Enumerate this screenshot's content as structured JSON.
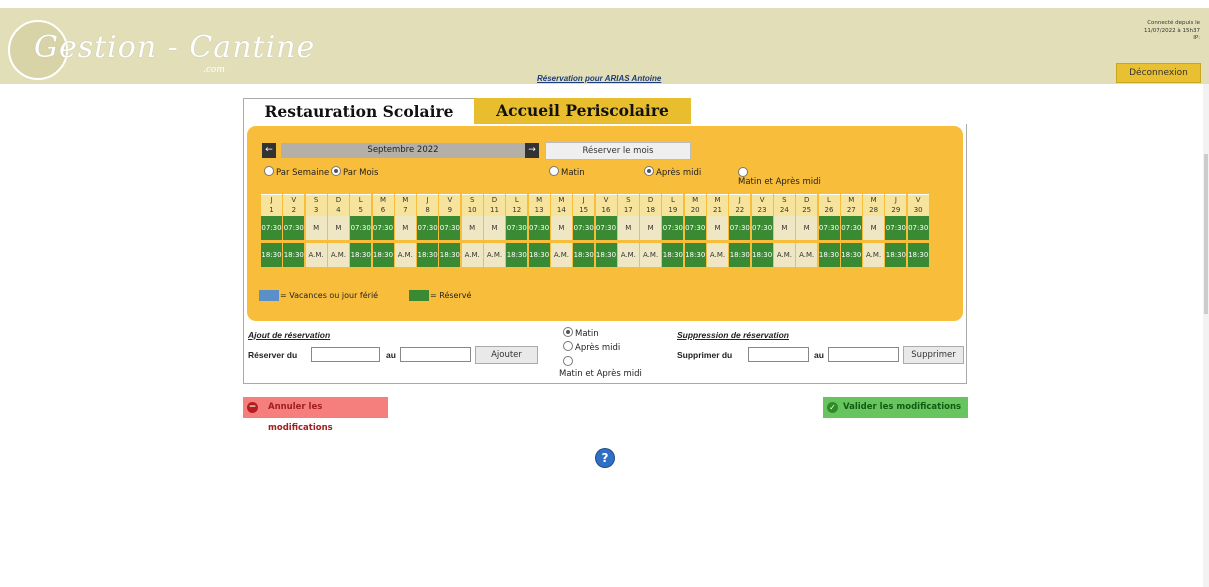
{
  "header": {
    "logo_text": "Gestion - Cantine",
    "logo_sub": ".com",
    "reservation_for": "Réservation pour ARIAS Antoine",
    "connection": [
      "Connecté depuis le",
      "11/07/2022 à 15h37",
      "IP:"
    ],
    "logout_label": "Déconnexion"
  },
  "tabs": [
    "Restauration Scolaire",
    "Accueil Periscolaire"
  ],
  "calendar": {
    "month_label": "Septembre 2022",
    "prev_icon": "←",
    "next_icon": "→",
    "reserve_month_label": "Réserver le mois",
    "view_options": [
      "Par Semaine",
      "Par Mois"
    ],
    "view_selected": "Par Mois",
    "period_options": [
      "Matin",
      "Après midi",
      "Matin et Après midi"
    ],
    "period_selected": "Après midi",
    "days": [
      {
        "l": "J",
        "n": "1",
        "am": "07:30",
        "pm": "18:30",
        "r": true
      },
      {
        "l": "V",
        "n": "2",
        "am": "07:30",
        "pm": "18:30",
        "r": true
      },
      {
        "l": "S",
        "n": "3",
        "am": "M",
        "pm": "A.M.",
        "r": false
      },
      {
        "l": "D",
        "n": "4",
        "am": "M",
        "pm": "A.M.",
        "r": false
      },
      {
        "l": "L",
        "n": "5",
        "am": "07:30",
        "pm": "18:30",
        "r": true
      },
      {
        "l": "M",
        "n": "6",
        "am": "07:30",
        "pm": "18:30",
        "r": true
      },
      {
        "l": "M",
        "n": "7",
        "am": "M",
        "pm": "A.M.",
        "r": false
      },
      {
        "l": "J",
        "n": "8",
        "am": "07:30",
        "pm": "18:30",
        "r": true
      },
      {
        "l": "V",
        "n": "9",
        "am": "07:30",
        "pm": "18:30",
        "r": true
      },
      {
        "l": "S",
        "n": "10",
        "am": "M",
        "pm": "A.M.",
        "r": false
      },
      {
        "l": "D",
        "n": "11",
        "am": "M",
        "pm": "A.M.",
        "r": false
      },
      {
        "l": "L",
        "n": "12",
        "am": "07:30",
        "pm": "18:30",
        "r": true
      },
      {
        "l": "M",
        "n": "13",
        "am": "07:30",
        "pm": "18:30",
        "r": true
      },
      {
        "l": "M",
        "n": "14",
        "am": "M",
        "pm": "A.M.",
        "r": false
      },
      {
        "l": "J",
        "n": "15",
        "am": "07:30",
        "pm": "18:30",
        "r": true
      },
      {
        "l": "V",
        "n": "16",
        "am": "07:30",
        "pm": "18:30",
        "r": true
      },
      {
        "l": "S",
        "n": "17",
        "am": "M",
        "pm": "A.M.",
        "r": false
      },
      {
        "l": "D",
        "n": "18",
        "am": "M",
        "pm": "A.M.",
        "r": false
      },
      {
        "l": "L",
        "n": "19",
        "am": "07:30",
        "pm": "18:30",
        "r": true
      },
      {
        "l": "M",
        "n": "20",
        "am": "07:30",
        "pm": "18:30",
        "r": true
      },
      {
        "l": "M",
        "n": "21",
        "am": "M",
        "pm": "A.M.",
        "r": false
      },
      {
        "l": "J",
        "n": "22",
        "am": "07:30",
        "pm": "18:30",
        "r": true
      },
      {
        "l": "V",
        "n": "23",
        "am": "07:30",
        "pm": "18:30",
        "r": true
      },
      {
        "l": "S",
        "n": "24",
        "am": "M",
        "pm": "A.M.",
        "r": false
      },
      {
        "l": "D",
        "n": "25",
        "am": "M",
        "pm": "A.M.",
        "r": false
      },
      {
        "l": "L",
        "n": "26",
        "am": "07:30",
        "pm": "18:30",
        "r": true
      },
      {
        "l": "M",
        "n": "27",
        "am": "07:30",
        "pm": "18:30",
        "r": true
      },
      {
        "l": "M",
        "n": "28",
        "am": "M",
        "pm": "A.M.",
        "r": false
      },
      {
        "l": "J",
        "n": "29",
        "am": "07:30",
        "pm": "18:30",
        "r": true
      },
      {
        "l": "V",
        "n": "30",
        "am": "07:30",
        "pm": "18:30",
        "r": true
      }
    ],
    "colors": {
      "reserved": "#3a8a33",
      "free": "#efe6c4",
      "header": "#f6e49c",
      "holiday": "#5a8fc8"
    },
    "legend_holiday": "= Vacances ou jour férié",
    "legend_reserved": "= Réservé"
  },
  "add_reservation": {
    "title": "Ajout de réservation",
    "from_label": "Réserver du",
    "to_label": "au",
    "from_value": "",
    "to_value": "",
    "button": "Ajouter"
  },
  "period": {
    "options": [
      "Matin",
      "Après midi",
      "Matin et Après midi"
    ],
    "selected": "Matin"
  },
  "remove_reservation": {
    "title": "Suppression de réservation",
    "from_label": "Supprimer du",
    "to_label": "au",
    "from_value": "",
    "to_value": "",
    "button": "Supprimer"
  },
  "actions": {
    "cancel": "Annuler les modifications",
    "validate": "Valider les modifications",
    "help_icon": "?"
  }
}
